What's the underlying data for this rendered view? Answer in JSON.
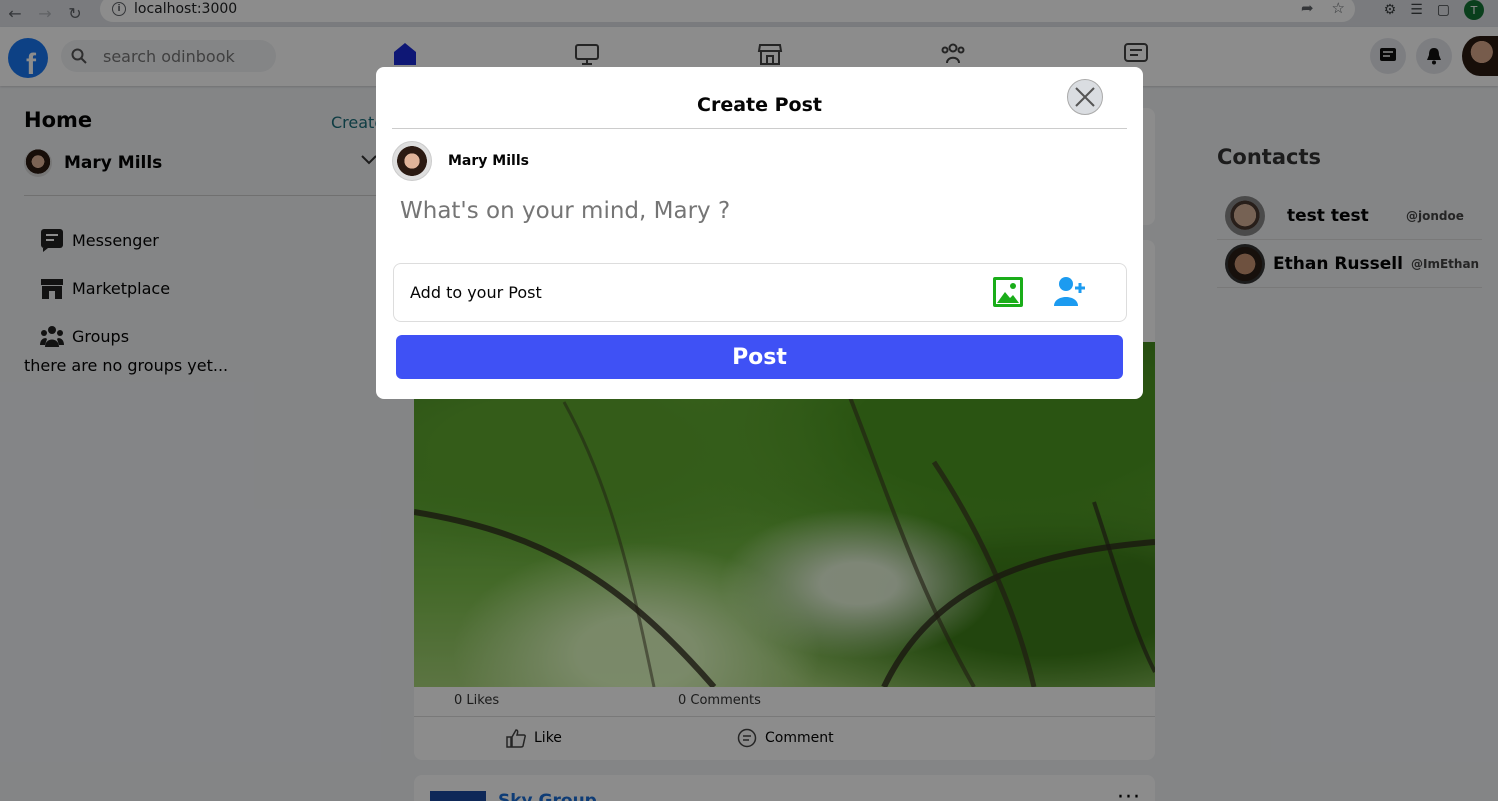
{
  "browser": {
    "url": "localhost:3000",
    "profile_initial": "T"
  },
  "header": {
    "logo_letter": "f",
    "search_placeholder": "search odinbook"
  },
  "sidebar": {
    "title": "Home",
    "create_link": "Create",
    "user_name": "Mary Mills",
    "items": [
      {
        "label": "Messenger",
        "icon": "messenger-icon"
      },
      {
        "label": "Marketplace",
        "icon": "marketplace-icon"
      },
      {
        "label": "Groups",
        "icon": "groups-icon"
      }
    ],
    "empty_groups": "there are no groups yet..."
  },
  "feed": {
    "post": {
      "likes": "0 Likes",
      "comments": "0 Comments",
      "like_label": "Like",
      "comment_label": "Comment"
    },
    "next_post_group": "Sky Group"
  },
  "contacts": {
    "title": "Contacts",
    "list": [
      {
        "name": "test test",
        "handle": "@jondoe"
      },
      {
        "name": "Ethan Russell",
        "handle": "@ImEthan"
      }
    ]
  },
  "modal": {
    "title": "Create Post",
    "user_name": "Mary Mills",
    "placeholder": "What's on your mind, Mary ?",
    "add_label": "Add to your Post",
    "post_label": "Post"
  },
  "colors": {
    "brand": "#1877f2",
    "post_button": "#3f51f5",
    "image_icon": "#1aad19",
    "tag_icon": "#1c9bf0",
    "nav_active": "#1b2bd6"
  }
}
